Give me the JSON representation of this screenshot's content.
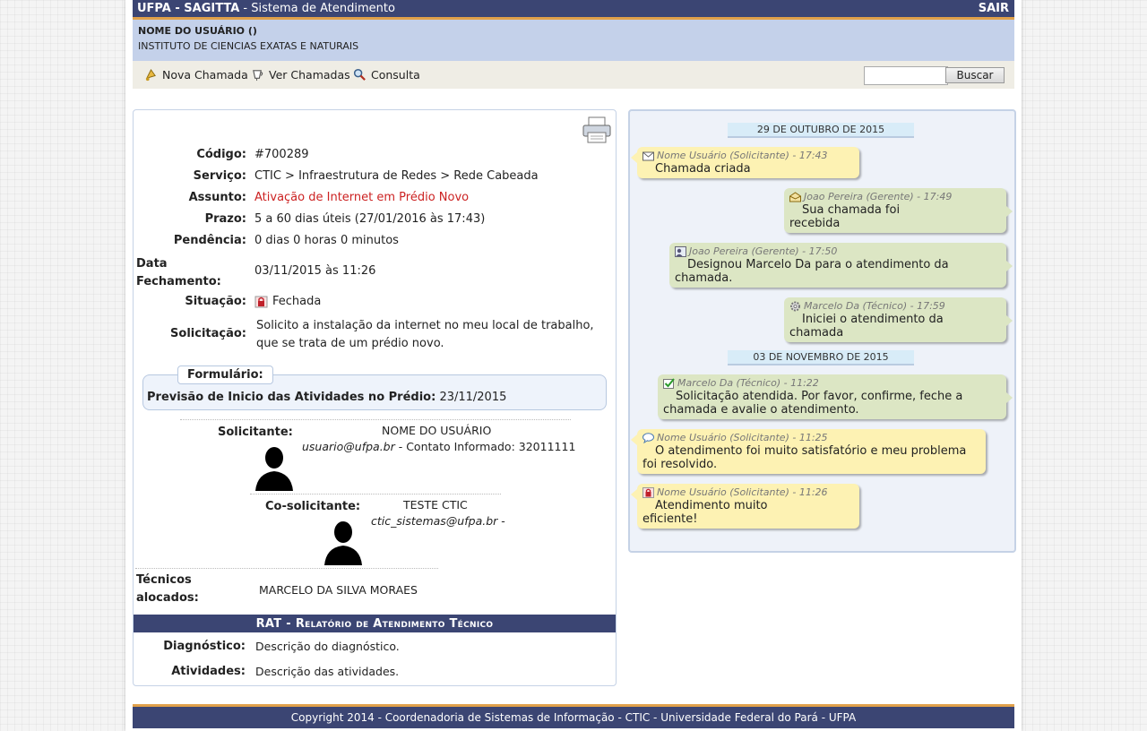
{
  "header": {
    "title_brand": "UFPA - SAGITTA",
    "title_rest": " - Sistema de Atendimento",
    "logout_label": "SAIR"
  },
  "user": {
    "name": "NOME DO USUÁRIO ()",
    "institute": "INSTITUTO DE CIENCIAS EXATAS E NATURAIS"
  },
  "menu": {
    "items": [
      {
        "label": "Nova Chamada",
        "icon": "bell-icon"
      },
      {
        "label": "Ver Chamadas",
        "icon": "cup-icon"
      },
      {
        "label": "Consulta",
        "icon": "magnifier-icon"
      }
    ],
    "search_placeholder": "",
    "search_button": "Buscar"
  },
  "ticket": {
    "codigo_label": "Código:",
    "codigo": "#700289",
    "servico_label": "Serviço:",
    "servico": "CTIC > Infraestrutura de Redes > Rede Cabeada",
    "assunto_label": "Assunto:",
    "assunto": "Ativação de Internet em Prédio Novo",
    "prazo_label": "Prazo:",
    "prazo": "5 a 60 dias úteis (27/01/2016 às 17:43)",
    "pendencia_label": "Pendência:",
    "pendencia": "0 dias 0 horas 0 minutos",
    "fechamento_label_1": "Data",
    "fechamento_label_2": "Fechamento:",
    "fechamento": "03/11/2015 às 11:26",
    "situacao_label": "Situação:",
    "situacao": "Fechada",
    "solicitacao_label": "Solicitação:",
    "solicitacao_1": "Solicito a instalação da internet no meu local de trabalho,",
    "solicitacao_2": "que se trata de um prédio novo.",
    "formulario_title": "Formulário:",
    "formulario_q": "Previsão de Inicio das Atividades no Prédio:",
    "formulario_a": "23/11/2015",
    "solicitante_label": "Solicitante:",
    "solicitante_name": "NOME DO USUÁRIO",
    "solicitante_email": "usuario@ufpa.br",
    "solicitante_contact": " - Contato Informado: 32011111",
    "cosolicitante_label": "Co-solicitante:",
    "cosolicitante_name": "TESTE CTIC",
    "cosolicitante_email": "ctic_sistemas@ufpa.br",
    "cosolicitante_suffix": " -",
    "tecnicos_label_1": "Técnicos",
    "tecnicos_label_2": "alocados:",
    "tecnicos": "MARCELO DA SILVA MORAES"
  },
  "rat": {
    "title_strong": "RAT",
    "title_rest": " - Relatório de Atendimento Técnico",
    "diagnostico_label": "Diagnóstico:",
    "diagnostico": "Descrição do diagnóstico.",
    "atividades_label": "Atividades:",
    "atividades": "Descrição das atividades."
  },
  "timeline": {
    "date1": "29 DE OUTUBRO DE 2015",
    "date2": "03 DE NOVEMBRO DE 2015",
    "messages": [
      {
        "meta": "Nome Usuário (Solicitante) - 17:43",
        "text": "Chamada criada",
        "side": "left",
        "icon": "envelope-icon"
      },
      {
        "meta": "Joao Pereira (Gerente) - 17:49",
        "text_1": "Sua chamada foi",
        "text_2": "recebida",
        "side": "right",
        "icon": "open-envelope-icon"
      },
      {
        "meta": "Joao Pereira (Gerente) - 17:50",
        "text_1": "Designou Marcelo Da para o atendimento da",
        "text_2": "chamada.",
        "side": "right",
        "icon": "user-card-icon"
      },
      {
        "meta": "Marcelo Da (Técnico) - 17:59",
        "text_1": "Iniciei o atendimento da",
        "text_2": "chamada",
        "side": "right",
        "icon": "gear-icon"
      },
      {
        "meta": "Marcelo Da (Técnico) - 11:22",
        "text_1": "Solicitação atendida. Por favor, confirme, feche a",
        "text_2": "chamada e avalie o atendimento.",
        "side": "right",
        "icon": "check-icon"
      },
      {
        "meta": "Nome Usuário (Solicitante) - 11:25",
        "text_1": "O atendimento foi muito satisfatório e meu problema",
        "text_2": "foi resolvido.",
        "side": "left",
        "icon": "speech-icon"
      },
      {
        "meta": "Nome Usuário (Solicitante) - 11:26",
        "text_1": "Atendimento muito",
        "text_2": "eficiente!",
        "side": "left",
        "icon": "lock-icon"
      }
    ]
  },
  "footer": {
    "text": "Copyright 2014 - Coordenadoria de Sistemas de Informação - CTIC - Universidade Federal do Pará - UFPA"
  }
}
